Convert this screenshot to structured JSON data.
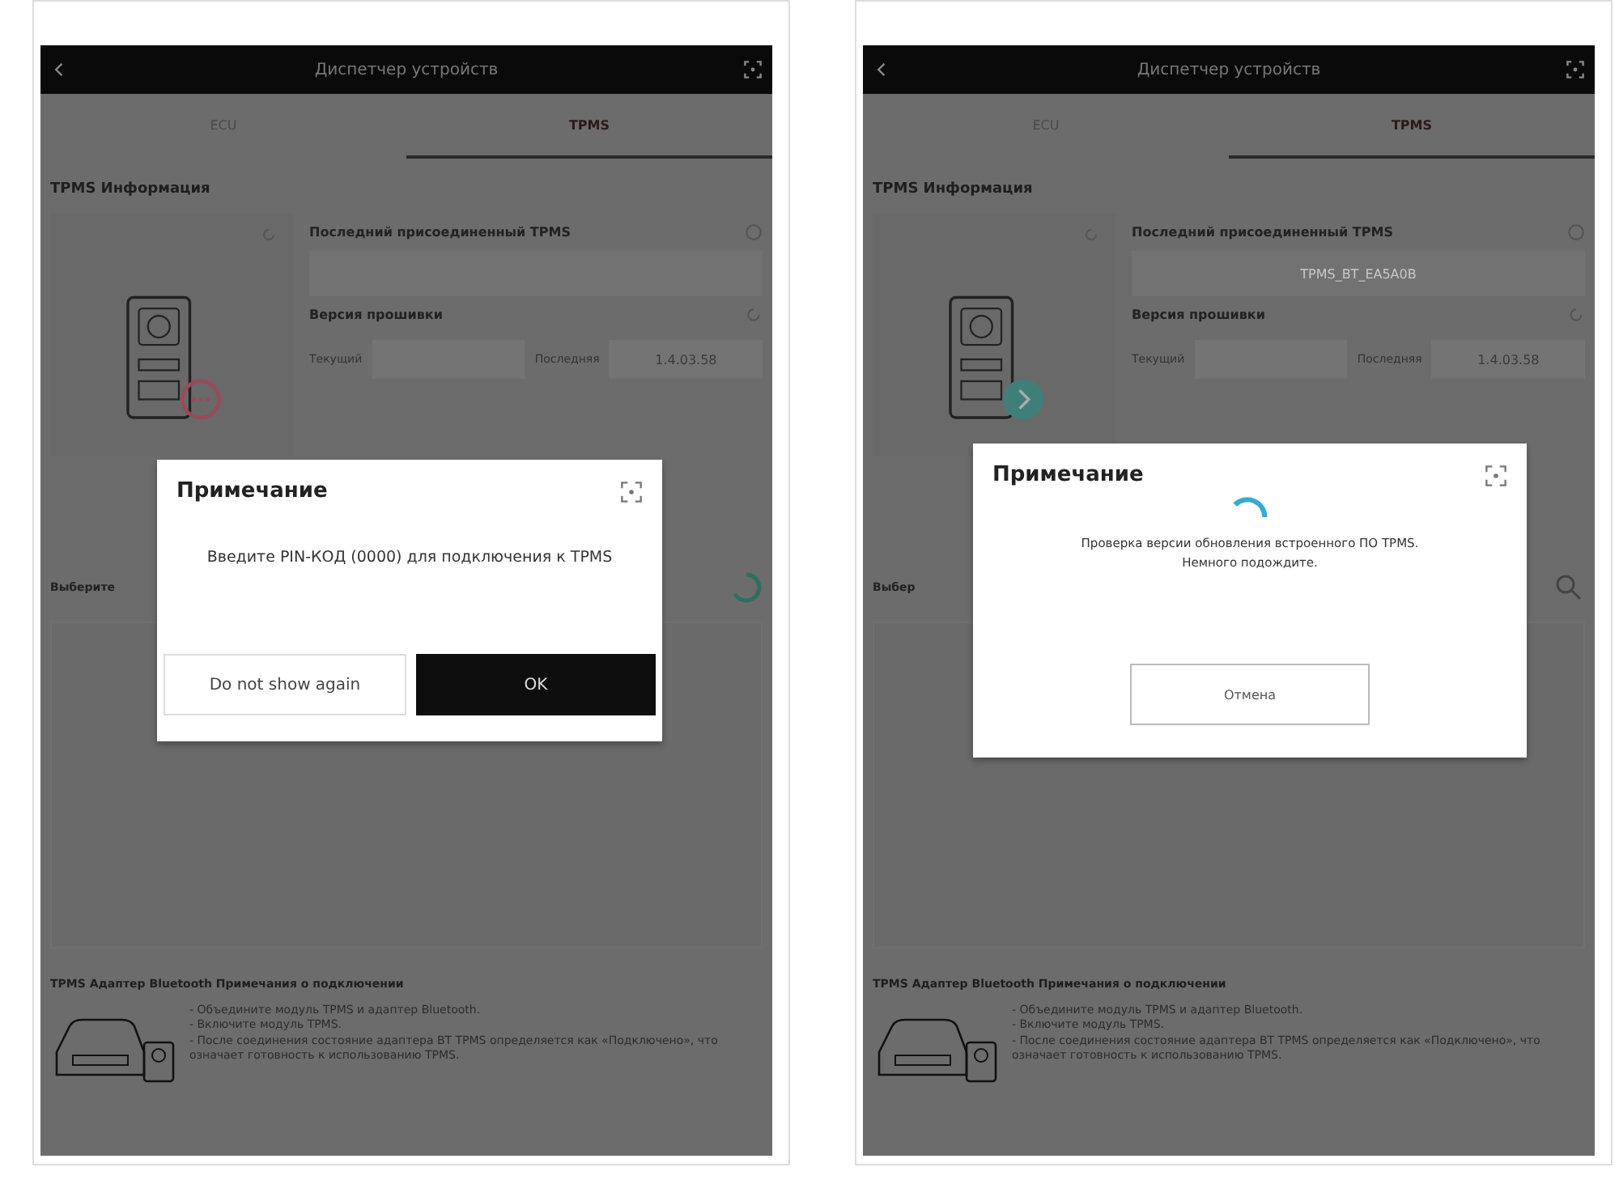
{
  "panels": [
    {
      "header": {
        "title": "Диспетчер устройств"
      },
      "tabs": [
        {
          "label": "ECU",
          "selected": false
        },
        {
          "label": "TPMS",
          "selected": true
        }
      ],
      "section_title": "TPMS Информация",
      "connected": false,
      "last_connected": {
        "title": "Последний присоединенный TPMS"
      },
      "firmware": {
        "title": "Версия прошивки",
        "current_label": "Текущий",
        "latest_label": "Последняя",
        "latest_value": "1.4.03.58"
      },
      "select": {
        "label": "Выберите",
        "kind": "spinner"
      },
      "notes": {
        "title": "TPMS Адаптер Bluetooth Примечания о подключении",
        "bullets": [
          "- Объедините модуль TPMS и адаптер Bluetooth.",
          "- Включите модуль TPMS.",
          "- После соединения состояние адаптера BT TPMS определяется как «Подключено», что означает готовность к использованию TPMS."
        ]
      },
      "dialog": {
        "kind": "pin",
        "title": "Примечание",
        "message_lines": [
          "Введите PIN-КОД (0000) для подключения к TPMS"
        ],
        "buttons": [
          {
            "label": "Do not show again",
            "kind": "secondary"
          },
          {
            "label": "OK",
            "kind": "primary"
          }
        ]
      }
    },
    {
      "header": {
        "title": "Диспетчер устройств"
      },
      "tabs": [
        {
          "label": "ECU",
          "selected": false
        },
        {
          "label": "TPMS",
          "selected": true
        }
      ],
      "section_title": "TPMS Информация",
      "connected": true,
      "last_connected": {
        "title": "Последний присоединенный TPMS",
        "value": "TPMS_BT_EA5A0B"
      },
      "firmware": {
        "title": "Версия прошивки",
        "current_label": "Текущий",
        "latest_label": "Последняя",
        "latest_value": "1.4.03.58"
      },
      "select": {
        "label": "Выбер",
        "kind": "search"
      },
      "notes": {
        "title": "TPMS Адаптер Bluetooth Примечания о подключении",
        "bullets": [
          "- Объедините модуль TPMS и адаптер Bluetooth.",
          "- Включите модуль TPMS.",
          "- После соединения состояние адаптера BT TPMS определяется как «Подключено», что означает готовность к использованию TPMS."
        ]
      },
      "dialog": {
        "kind": "progress",
        "title": "Примечание",
        "message_lines": [
          "Проверка версии обновления встроенного ПО TPMS.",
          "Немного подождите."
        ],
        "buttons": [
          {
            "label": "Отмена",
            "kind": "outline"
          }
        ]
      }
    }
  ]
}
